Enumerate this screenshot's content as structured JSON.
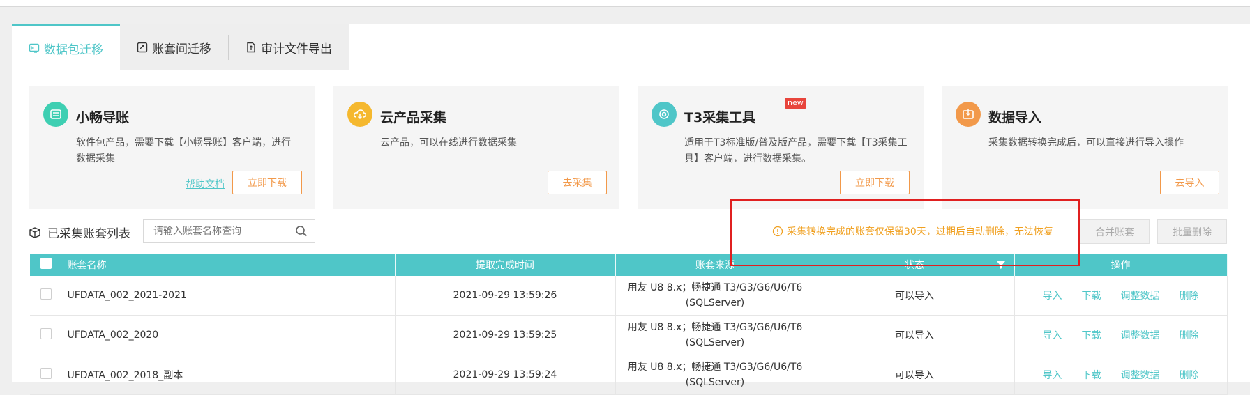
{
  "tabs": [
    {
      "label": "数据包迁移",
      "icon": "package-migrate-icon",
      "active": true
    },
    {
      "label": "账套间迁移",
      "icon": "link-migrate-icon",
      "active": false
    },
    {
      "label": "审计文件导出",
      "icon": "file-export-icon",
      "active": false
    }
  ],
  "cards": [
    {
      "title": "小畅导账",
      "desc": "软件包产品，需要下载【小畅导账】客户端，进行数据采集",
      "help": "帮助文档",
      "button": "立即下载",
      "color": "#3ecfb2",
      "icon": "transfer-icon"
    },
    {
      "title": "云产品采集",
      "desc": "云产品，可以在线进行数据采集",
      "button": "去采集",
      "color": "#f5b82e",
      "icon": "cloud-download-icon"
    },
    {
      "title": "T3采集工具",
      "badge": "new",
      "desc": "适用于T3标准版/普及版产品，需要下载【T3采集工具】客户端，进行数据采集。",
      "button": "立即下载",
      "color": "#4fc6c8",
      "icon": "gear-tool-icon"
    },
    {
      "title": "数据导入",
      "desc": "采集数据转换完成后，可以直接进行导入操作",
      "button": "去导入",
      "color": "#f2994a",
      "icon": "import-icon"
    }
  ],
  "list": {
    "title": "已采集账套列表",
    "search_placeholder": "请输入账套名称查询",
    "warning": "采集转换完成的账套仅保留30天，过期后自动删除，无法恢复",
    "merge_button": "合并账套",
    "batch_delete_button": "批量删除"
  },
  "table": {
    "headers": {
      "name": "账套名称",
      "time": "提取完成时间",
      "source": "账套来源",
      "status": "状态",
      "ops": "操作"
    },
    "rows": [
      {
        "name": "UFDATA_002_2021-2021",
        "time": "2021-09-29 13:59:26",
        "source": "用友 U8 8.x；畅捷通 T3/G3/G6/U6/T6 (SQLServer)",
        "status": "可以导入"
      },
      {
        "name": "UFDATA_002_2020",
        "time": "2021-09-29 13:59:25",
        "source": "用友 U8 8.x；畅捷通 T3/G3/G6/U6/T6 (SQLServer)",
        "status": "可以导入"
      },
      {
        "name": "UFDATA_002_2018_副本",
        "time": "2021-09-29 13:59:24",
        "source": "用友 U8 8.x；畅捷通 T3/G3/G6/U6/T6 (SQLServer)",
        "status": "可以导入"
      }
    ],
    "ops": [
      "导入",
      "下载",
      "调整数据",
      "删除"
    ]
  }
}
